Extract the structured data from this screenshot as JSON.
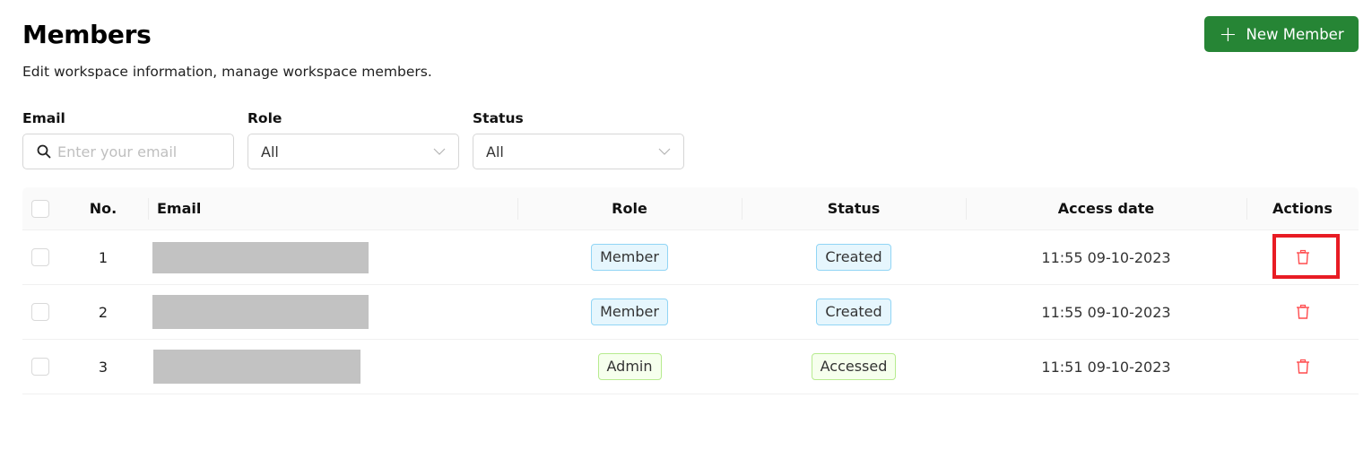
{
  "header": {
    "title": "Members",
    "subtitle": "Edit workspace information, manage workspace members.",
    "new_member_label": "New Member"
  },
  "filters": {
    "email": {
      "label": "Email",
      "placeholder": "Enter your email",
      "value": ""
    },
    "role": {
      "label": "Role",
      "value": "All"
    },
    "status": {
      "label": "Status",
      "value": "All"
    }
  },
  "table": {
    "columns": [
      "No.",
      "Email",
      "Role",
      "Status",
      "Access date",
      "Actions"
    ],
    "rows": [
      {
        "no": "1",
        "email": "[redacted]",
        "role": "Member",
        "status": "Created",
        "access_date": "11:55 09-10-2023"
      },
      {
        "no": "2",
        "email": "[redacted]",
        "role": "Member",
        "status": "Created",
        "access_date": "11:55 09-10-2023"
      },
      {
        "no": "3",
        "email": "[redacted]",
        "role": "Admin",
        "status": "Accessed",
        "access_date": "11:51 09-10-2023"
      }
    ]
  },
  "colors": {
    "primary_green": "#268535",
    "danger_red": "#ff4d4f",
    "highlight_red": "#e81c24",
    "tag_blue_bg": "#e6f6fd",
    "tag_green_bg": "#f6ffed"
  },
  "annotation": {
    "highlighted_element": "row-1-delete-button"
  }
}
